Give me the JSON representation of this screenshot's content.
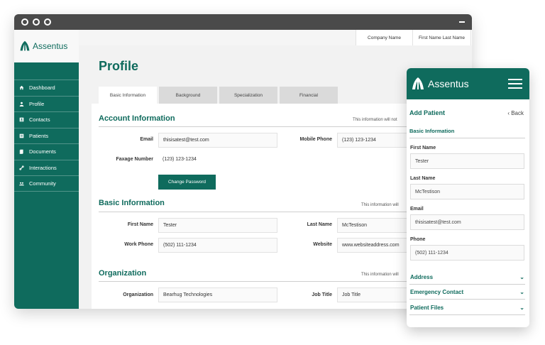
{
  "brand": {
    "name": "Assentus",
    "color": "#0f6b5d"
  },
  "window": {
    "title_dots": [
      "dot",
      "dot",
      "dot"
    ]
  },
  "header": {
    "company": "Company Name",
    "user": "First Name Last Name",
    "settings_icon": "gear-icon"
  },
  "sidebar": {
    "items": [
      {
        "label": "Dashboard",
        "icon": "home-icon"
      },
      {
        "label": "Profile",
        "icon": "user-icon"
      },
      {
        "label": "Contacts",
        "icon": "contact-card-icon"
      },
      {
        "label": "Patients",
        "icon": "patient-icon"
      },
      {
        "label": "Documents",
        "icon": "documents-icon"
      },
      {
        "label": "Interactions",
        "icon": "link-icon"
      },
      {
        "label": "Community",
        "icon": "community-icon"
      }
    ]
  },
  "page": {
    "title": "Profile",
    "tabs": [
      "Basic Information",
      "Background",
      "Specialization",
      "Financial"
    ],
    "account": {
      "heading": "Account Information",
      "note": "This information will not",
      "email_label": "Email",
      "email_value": "thisisatest@test.com",
      "mobile_label": "Mobile Phone",
      "mobile_value": "(123) 123-1234",
      "fax_label": "Faxage Number",
      "fax_value": "(123) 123-1234",
      "change_password": "Change Password"
    },
    "basic": {
      "heading": "Basic Information",
      "note": "This information will",
      "first_label": "First Name",
      "first_value": "Tester",
      "last_label": "Last Name",
      "last_value": "McTestison",
      "work_label": "Work Phone",
      "work_value": "(502) 111-1234",
      "website_label": "Website",
      "website_value": "www.websiteaddress.com"
    },
    "org": {
      "heading": "Organization",
      "note": "This information will",
      "org_label": "Organization",
      "org_value": "Bearhug Technologies",
      "job_label": "Job Title",
      "job_placeholder": "Job Title"
    }
  },
  "mobile": {
    "brand": "Assentus",
    "title": "Add Patient",
    "back": "Back",
    "section": "Basic Information",
    "first_label": "First Name",
    "first_value": "Tester",
    "last_label": "Last Name",
    "last_value": "McTestison",
    "email_label": "Email",
    "email_value": "thisisatest@test.com",
    "phone_label": "Phone",
    "phone_value": "(502) 111-1234",
    "accordions": [
      "Address",
      "Emergency Contact",
      "Patient Files"
    ]
  }
}
